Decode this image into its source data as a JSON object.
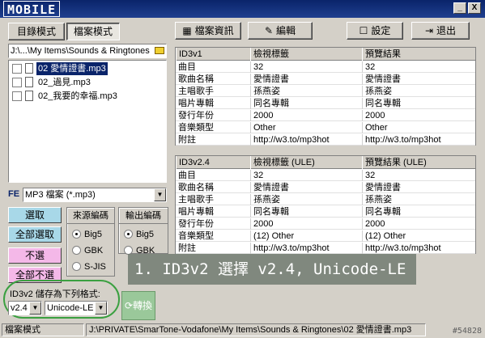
{
  "app": {
    "logo_text": "MOBILE"
  },
  "titlebar": {
    "minimize": "_",
    "close": "X"
  },
  "modes": {
    "catalog": "目錄模式",
    "file": "檔案模式"
  },
  "toolbar": {
    "file_info": "檔案資訊",
    "edit": "編輯",
    "settings": "設定",
    "exit": "退出"
  },
  "path": "J:\\...\\My Items\\Sounds & Ringtones",
  "files": [
    {
      "name": "02 愛情證書.mp3",
      "selected": true
    },
    {
      "name": "02_過見.mp3",
      "selected": false
    },
    {
      "name": "02_我要的幸福.mp3",
      "selected": false
    }
  ],
  "filter": {
    "label": "FE",
    "value": "MP3 檔案 (*.mp3)"
  },
  "select_buttons": {
    "select": "選取",
    "select_all": "全部選取",
    "deselect": "不選",
    "deselect_all": "全部不選"
  },
  "source_encoding": {
    "title": "來源編碼",
    "options": [
      "Big5",
      "GBK",
      "S-JIS"
    ],
    "selected": "Big5"
  },
  "output_encoding": {
    "title": "輸出編碼",
    "options": [
      "Big5",
      "GBK"
    ],
    "selected": "Big5"
  },
  "save_format": {
    "label": "ID3v2 儲存為下列格式:",
    "version": "v2.4",
    "encoding": "Unicode-LE"
  },
  "convert_button": "轉換",
  "id3v1": {
    "headers": [
      "ID3v1",
      "檢視標籤",
      "預覽結果"
    ],
    "rows": [
      [
        "曲目",
        "32",
        "32"
      ],
      [
        "歌曲名稱",
        "愛情證書",
        "愛情證書"
      ],
      [
        "主唱歌手",
        "孫燕姿",
        "孫燕姿"
      ],
      [
        "唱片專輯",
        "同名專輯",
        "同名專輯"
      ],
      [
        "發行年份",
        "2000",
        "2000"
      ],
      [
        "音樂類型",
        "Other",
        "Other"
      ],
      [
        "附註",
        "http://w3.to/mp3hot",
        "http://w3.to/mp3hot"
      ]
    ]
  },
  "id3v2": {
    "headers": [
      "ID3v2.4",
      "檢視標籤 (ULE)",
      "預覽結果 (ULE)"
    ],
    "rows": [
      [
        "曲目",
        "32",
        "32"
      ],
      [
        "歌曲名稱",
        "愛情證書",
        "愛情證書"
      ],
      [
        "主唱歌手",
        "孫燕姿",
        "孫燕姿"
      ],
      [
        "唱片專輯",
        "同名專輯",
        "同名專輯"
      ],
      [
        "發行年份",
        "2000",
        "2000"
      ],
      [
        "音樂類型",
        "(12) Other",
        "(12) Other"
      ],
      [
        "附註",
        "http://w3.to/mp3hot",
        "http://w3.to/mp3hot"
      ]
    ]
  },
  "caption": "1. ID3v2 選擇 v2.4, Unicode-LE",
  "status": {
    "mode": "檔案模式",
    "path": "J:\\PRIVATE\\SmarTone-Vodafone\\My Items\\Sounds & Ringtones\\02 愛情證書.mp3"
  },
  "watermark": "#54828"
}
